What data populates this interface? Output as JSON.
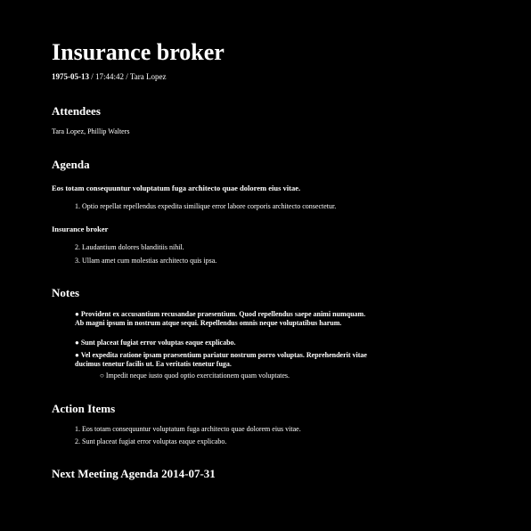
{
  "header": {
    "title": "Insurance broker",
    "date": "1975-05-13",
    "time": "17:44:42",
    "author": "Tara Lopez"
  },
  "attendees": {
    "heading": "Attendees",
    "names": "Tara Lopez, Phillip Walters"
  },
  "agenda": {
    "heading": "Agenda",
    "lead": "Eos totam consequuntur voluptatum fuga architecto quae dolorem eius vitae.",
    "items_1": [
      "1. Optio repellat repellendus expedita similique error labore corporis architecto consectetur."
    ],
    "subheading": "Insurance broker",
    "items_2": [
      "2. Laudantium dolores blanditiis nihil.",
      "3. Ullam amet cum molestias architecto quis ipsa."
    ]
  },
  "notes": {
    "heading": "Notes",
    "bullets": [
      "● Provident ex accusantium recusandae praesentium. Quod repellendus saepe animi numquam. Ab magni ipsum in nostrum atque sequi. Repellendus omnis neque voluptatibus harum.",
      "● Sunt placeat fugiat error voluptas eaque explicabo.",
      "● Vel expedita ratione ipsam praesentium pariatur nostrum porro voluptas. Reprehenderit vitae ducimus tenetur facilis ut. Ea veritatis tenetur fuga."
    ],
    "sub_bullet": "○ Impedit neque iusto quod optio exercitationem quam voluptates."
  },
  "action_items": {
    "heading": "Action Items",
    "items": [
      "1. Eos totam consequuntur voluptatum fuga architecto quae dolorem eius vitae.",
      "2. Sunt placeat fugiat error voluptas eaque explicabo."
    ]
  },
  "next_meeting": {
    "heading": "Next Meeting Agenda 2014-07-31"
  }
}
